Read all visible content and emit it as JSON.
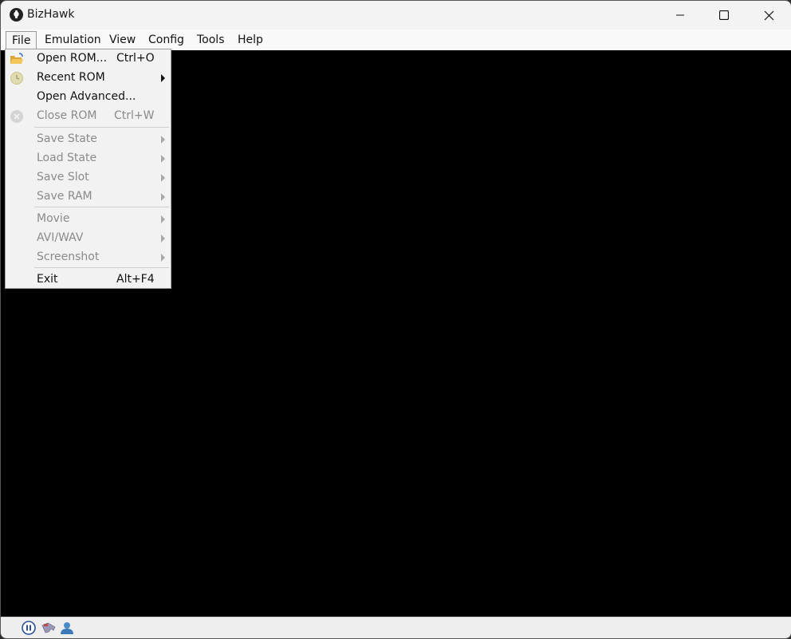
{
  "window": {
    "title": "BizHawk",
    "controls": {
      "minimize": "minimize",
      "maximize": "maximize",
      "close": "close"
    }
  },
  "menubar": {
    "items": [
      {
        "label": "File",
        "open": true
      },
      {
        "label": "Emulation"
      },
      {
        "label": "View"
      },
      {
        "label": "Config"
      },
      {
        "label": "Tools"
      },
      {
        "label": "Help"
      }
    ]
  },
  "file_menu": {
    "items": [
      {
        "label": "Open ROM...",
        "shortcut": "Ctrl+O",
        "icon": "open-folder-icon",
        "enabled": true,
        "submenu": false
      },
      {
        "label": "Recent ROM",
        "shortcut": "",
        "icon": "clock-icon",
        "enabled": true,
        "submenu": true
      },
      {
        "label": "Open Advanced...",
        "shortcut": "",
        "icon": "",
        "enabled": true,
        "submenu": false
      },
      {
        "label": "Close ROM",
        "shortcut": "Ctrl+W",
        "icon": "close-circle-icon",
        "enabled": false,
        "submenu": false
      },
      {
        "label": "Save State",
        "enabled": false,
        "submenu": true
      },
      {
        "label": "Load State",
        "enabled": false,
        "submenu": true
      },
      {
        "label": "Save Slot",
        "enabled": false,
        "submenu": true
      },
      {
        "label": "Save RAM",
        "enabled": false,
        "submenu": true
      },
      {
        "label": "Movie",
        "enabled": false,
        "submenu": true
      },
      {
        "label": "AVI/WAV",
        "enabled": false,
        "submenu": true
      },
      {
        "label": "Screenshot",
        "enabled": false,
        "submenu": true
      },
      {
        "label": "Exit",
        "shortcut": "Alt+F4",
        "enabled": true,
        "submenu": false
      }
    ]
  },
  "statusbar": {
    "icons": [
      "pause-icon",
      "controller-icon",
      "user-icon"
    ]
  }
}
